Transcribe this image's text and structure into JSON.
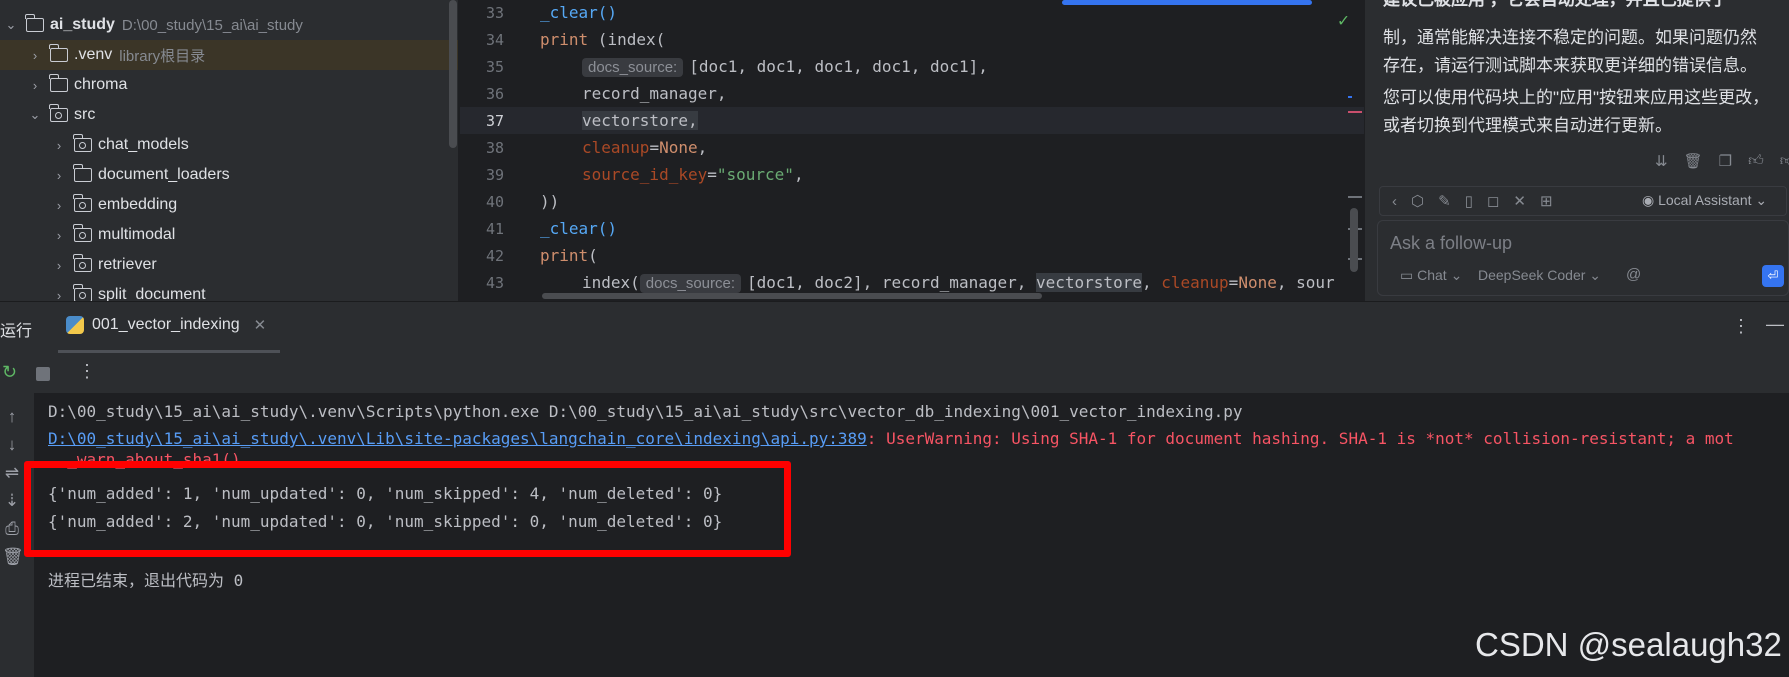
{
  "project_tree": {
    "items": [
      {
        "name": "ai_study",
        "path": "D:\\00_study\\15_ai\\ai_study",
        "chevron": "expanded"
      },
      {
        "name": ".venv",
        "path": "library根目录",
        "chevron": "collapsed"
      },
      {
        "name": "chroma",
        "path": "",
        "chevron": "collapsed"
      },
      {
        "name": "src",
        "path": "",
        "chevron": "expanded"
      },
      {
        "name": "chat_models",
        "path": "",
        "chevron": "collapsed"
      },
      {
        "name": "document_loaders",
        "path": "",
        "chevron": "collapsed"
      },
      {
        "name": "embedding",
        "path": "",
        "chevron": "collapsed"
      },
      {
        "name": "multimodal",
        "path": "",
        "chevron": "collapsed"
      },
      {
        "name": "retriever",
        "path": "",
        "chevron": "collapsed"
      },
      {
        "name": "split_document",
        "path": "",
        "chevron": "collapsed"
      }
    ]
  },
  "editor": {
    "line_numbers": [
      "33",
      "34",
      "35",
      "36",
      "37",
      "38",
      "39",
      "40",
      "41",
      "42",
      "43"
    ],
    "current_line": "37",
    "hint_docs_source": "docs_source:",
    "lines": {
      "l33": "_clear()",
      "l34_kw": "print",
      "l34_rest": " (index(",
      "l35_code": "[doc1, doc1, doc1, doc1, doc1],",
      "l36": "record_manager,",
      "l37": "vectorstore,",
      "l38_param": "cleanup",
      "l38_eq": "=",
      "l38_val": "None",
      "l38_comma": ",",
      "l39_param": "source_id_key",
      "l39_eq": "=",
      "l39_val": "\"source\"",
      "l39_comma": ",",
      "l40": "))",
      "l41": "_clear()",
      "l42_kw": "print",
      "l42_rest": "(",
      "l43_index": "index(",
      "l43_docs": "[doc1, doc2], record_manager, ",
      "l43_vs": "vectorstore",
      "l43_comma": ", ",
      "l43_param": "cleanup",
      "l43_eq": "=",
      "l43_val": "None",
      "l43_tail": ", sour"
    }
  },
  "assistant": {
    "top_partial": "建议已被应用 ，它会自动处理，并且已提供了",
    "para1_line1": "制，通常能解决连接不稳定的问题。如果问题仍然",
    "para1_line2": "存在，请运行测试脚本来获取更详细的错误信息。",
    "para2_line1": "您可以使用代码块上的\"应用\"按钮来应用这些更改，",
    "para2_line2": "或者切换到代理模式来自动进行更新。",
    "local_assistant": "Local Assistant",
    "followup_placeholder": "Ask a follow-up",
    "chat_mode": "Chat",
    "model": "DeepSeek Coder",
    "at_symbol": "@"
  },
  "run_window": {
    "title": "运行",
    "tab_label": "001_vector_indexing"
  },
  "console": {
    "cmd": "D:\\00_study\\15_ai\\ai_study\\.venv\\Scripts\\python.exe D:\\00_study\\15_ai\\ai_study\\src\\vector_db_indexing\\001_vector_indexing.py",
    "warn_link": "D:\\00_study\\15_ai\\ai_study\\.venv\\Lib\\site-packages\\langchain_core\\indexing\\api.py:389",
    "warn_text": ": UserWarning: Using SHA-1 for document hashing. SHA-1 is *not* collision-resistant; a mot",
    "warn_call": "  _warn_about_sha1()",
    "result1": "{'num_added': 1, 'num_updated': 0, 'num_skipped': 4, 'num_deleted': 0}",
    "result2": "{'num_added': 2, 'num_updated': 0, 'num_skipped': 0, 'num_deleted': 0}",
    "exit_msg": "进程已结束，退出代码为 0"
  },
  "watermark": "CSDN @sealaugh32",
  "colors": {
    "accent": "#3574f0",
    "keyword": "#cf8e6d",
    "string": "#6aab73",
    "error": "#f75464",
    "link": "#589df6",
    "highlight_box": "#ff0000"
  }
}
